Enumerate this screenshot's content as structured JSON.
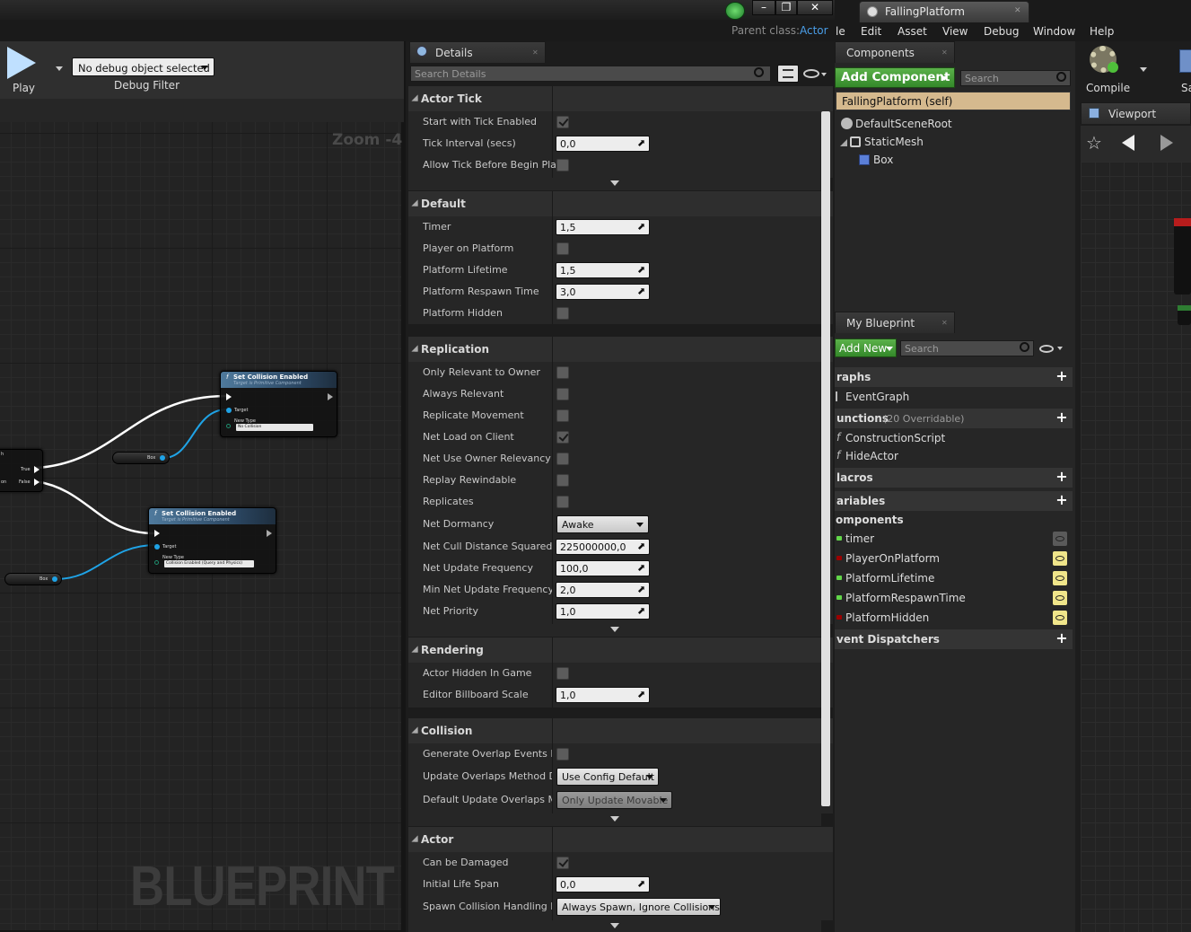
{
  "window": {
    "tab_title": "FallingPlatform",
    "parent_class_label": "Parent class:",
    "parent_class_value": "Actor"
  },
  "menu": [
    "le",
    "Edit",
    "Asset",
    "View",
    "Debug",
    "Window",
    "Help"
  ],
  "toolbar": {
    "play_label": "Play",
    "debug_object": "No debug object selected",
    "debug_filter": "Debug Filter",
    "compile_label": "Compile",
    "save_label": "Sa"
  },
  "graph": {
    "zoom": "Zoom -4",
    "watermark": "BLUEPRINT",
    "node1": {
      "title": "Set Collision Enabled",
      "subtitle": "Target is Primitive Component",
      "target": "Target",
      "new_type": "New Type",
      "value": "No Collision"
    },
    "node2": {
      "title": "Set Collision Enabled",
      "subtitle": "Target is Primitive Component",
      "target": "Target",
      "new_type": "New Type",
      "value": "Collision Enabled (Query and Physics)"
    },
    "branch": {
      "true_label": "True",
      "false_label": "False",
      "partial_top": "h",
      "partial_left": "on"
    },
    "get_box1": "Box",
    "get_box2": "Box"
  },
  "details": {
    "tab": "Details",
    "search_placeholder": "Search Details",
    "categories": {
      "actor_tick": "Actor Tick",
      "default": "Default",
      "replication": "Replication",
      "rendering": "Rendering",
      "collision": "Collision",
      "actor": "Actor"
    },
    "props": {
      "start_tick": {
        "label": "Start with Tick Enabled",
        "checked": true
      },
      "tick_interval": {
        "label": "Tick Interval (secs)",
        "value": "0,0"
      },
      "allow_tick": {
        "label": "Allow Tick Before Begin Play",
        "checked": false
      },
      "timer": {
        "label": "Timer",
        "value": "1,5"
      },
      "player_on_platform": {
        "label": "Player on Platform",
        "checked": false
      },
      "platform_lifetime": {
        "label": "Platform Lifetime",
        "value": "1,5"
      },
      "platform_respawn": {
        "label": "Platform Respawn Time",
        "value": "3,0"
      },
      "platform_hidden": {
        "label": "Platform Hidden",
        "checked": false
      },
      "only_relevant": {
        "label": "Only Relevant to Owner",
        "checked": false
      },
      "always_relevant": {
        "label": "Always Relevant",
        "checked": false
      },
      "replicate_movement": {
        "label": "Replicate Movement",
        "checked": false
      },
      "net_load": {
        "label": "Net Load on Client",
        "checked": true
      },
      "net_use_owner": {
        "label": "Net Use Owner Relevancy",
        "checked": false
      },
      "replay_rewindable": {
        "label": "Replay Rewindable",
        "checked": false
      },
      "replicates": {
        "label": "Replicates",
        "checked": false
      },
      "net_dormancy": {
        "label": "Net Dormancy",
        "value": "Awake"
      },
      "net_cull": {
        "label": "Net Cull Distance Squared",
        "value": "225000000,0"
      },
      "net_update": {
        "label": "Net Update Frequency",
        "value": "100,0"
      },
      "min_net_update": {
        "label": "Min Net Update Frequency",
        "value": "2,0"
      },
      "net_priority": {
        "label": "Net Priority",
        "value": "1,0"
      },
      "actor_hidden": {
        "label": "Actor Hidden In Game",
        "checked": false
      },
      "billboard_scale": {
        "label": "Editor Billboard Scale",
        "value": "1,0"
      },
      "gen_overlap": {
        "label": "Generate Overlap Events Dur",
        "checked": false
      },
      "update_overlaps": {
        "label": "Update Overlaps Method Dur",
        "value": "Use Config Default"
      },
      "default_update_overlaps": {
        "label": "Default Update Overlaps Met",
        "value": "Only Update Movable"
      },
      "can_be_damaged": {
        "label": "Can be Damaged",
        "checked": true
      },
      "initial_life": {
        "label": "Initial Life Span",
        "value": "0,0"
      },
      "spawn_collision": {
        "label": "Spawn Collision Handling Me",
        "value": "Always Spawn, Ignore Collisions"
      }
    }
  },
  "components": {
    "tab": "Components",
    "add_button": "Add Component",
    "search_placeholder": "Search",
    "self_item": "FallingPlatform (self)",
    "tree": [
      "DefaultSceneRoot",
      "StaticMesh",
      "Box"
    ]
  },
  "my_blueprint": {
    "tab": "My Blueprint",
    "add_new": "Add New",
    "search_placeholder": "Search",
    "sections": {
      "graphs": "raphs",
      "functions": "unctions",
      "functions_count": "(20 Overridable)",
      "macros": "lacros",
      "variables": "ariables",
      "components": "omponents",
      "dispatchers": "vent Dispatchers"
    },
    "graphs": [
      "EventGraph"
    ],
    "functions": [
      "ConstructionScript",
      "HideActor"
    ],
    "variables": [
      {
        "name": "timer",
        "color": "#62d64a",
        "visible": false
      },
      {
        "name": "PlayerOnPlatform",
        "color": "#9b0000",
        "visible": true
      },
      {
        "name": "PlatformLifetime",
        "color": "#62d64a",
        "visible": true
      },
      {
        "name": "PlatformRespawnTime",
        "color": "#62d64a",
        "visible": true
      },
      {
        "name": "PlatformHidden",
        "color": "#9b0000",
        "visible": true
      }
    ]
  },
  "viewport": {
    "tab": "Viewport"
  }
}
